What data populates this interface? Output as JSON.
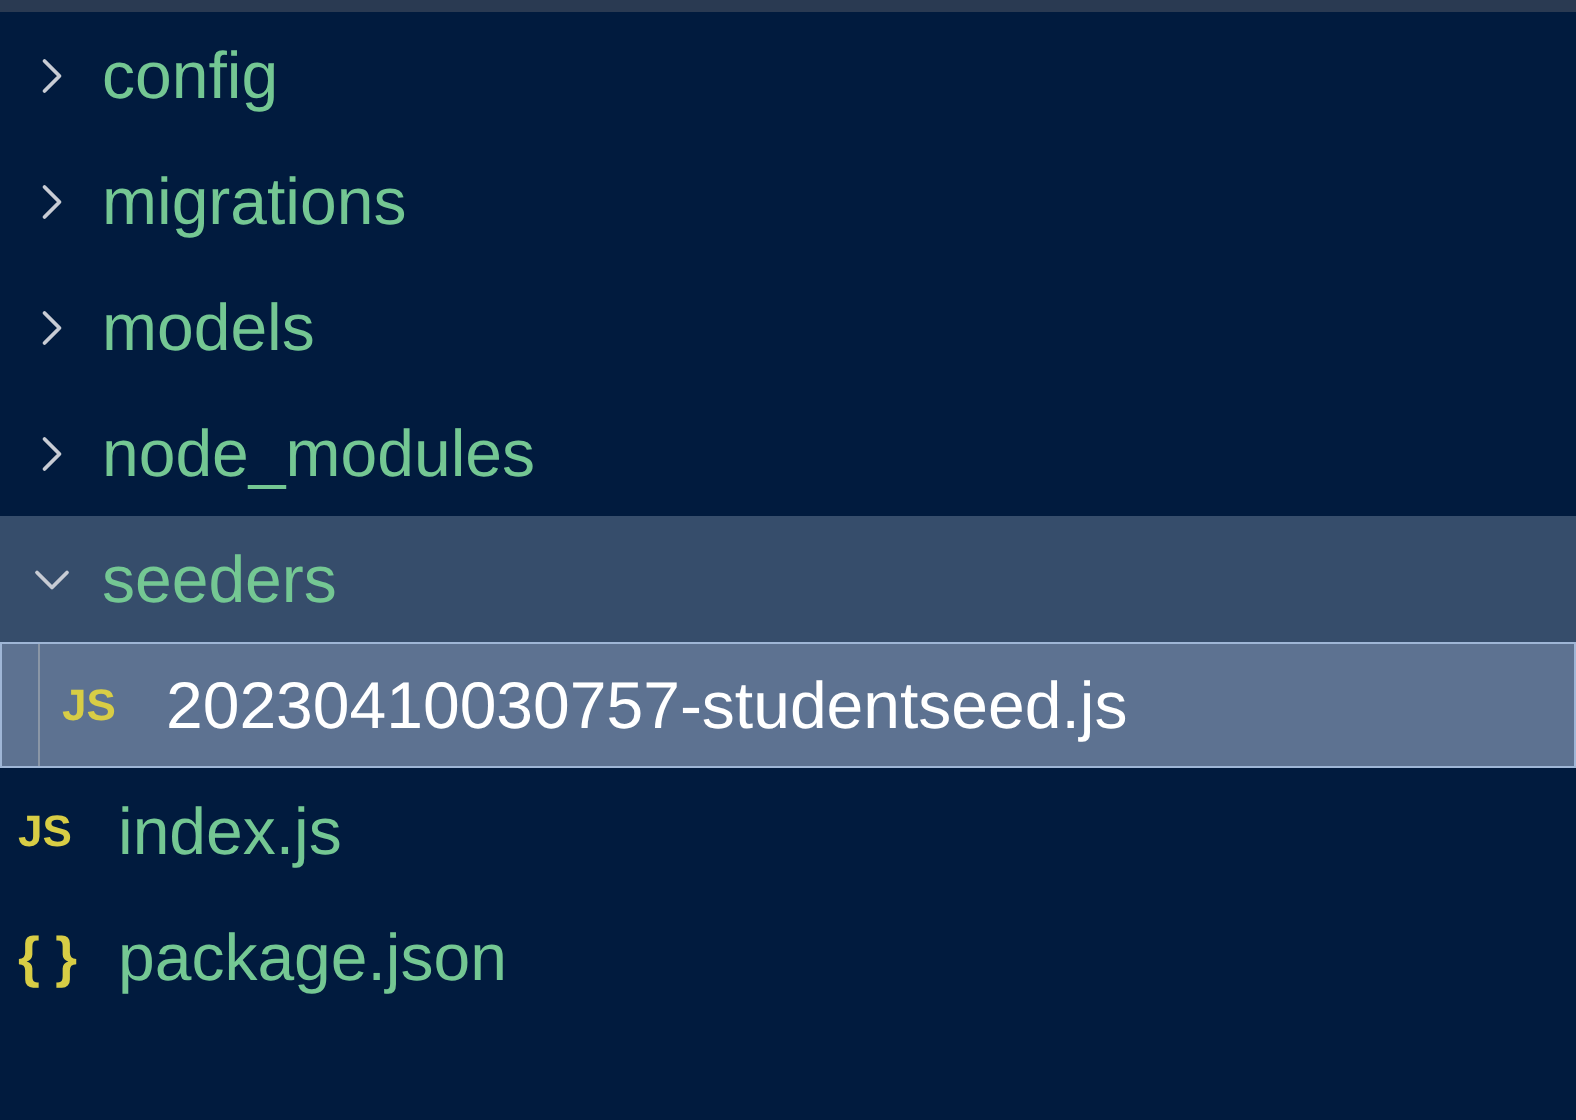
{
  "tree": [
    {
      "kind": "folder",
      "name": "config",
      "expanded": false,
      "highlighted": false,
      "selected": false
    },
    {
      "kind": "folder",
      "name": "migrations",
      "expanded": false,
      "highlighted": false,
      "selected": false
    },
    {
      "kind": "folder",
      "name": "models",
      "expanded": false,
      "highlighted": false,
      "selected": false
    },
    {
      "kind": "folder",
      "name": "node_modules",
      "expanded": false,
      "highlighted": false,
      "selected": false
    },
    {
      "kind": "folder",
      "name": "seeders",
      "expanded": true,
      "highlighted": true,
      "selected": false,
      "children": [
        {
          "kind": "js",
          "icon": "JS",
          "name": "20230410030757-studentseed.js",
          "highlighted": false,
          "selected": true
        }
      ]
    },
    {
      "kind": "js",
      "icon": "JS",
      "name": "index.js",
      "highlighted": false,
      "selected": false
    },
    {
      "kind": "json",
      "icon": "{ }",
      "name": "package.json",
      "highlighted": false,
      "selected": false
    }
  ]
}
